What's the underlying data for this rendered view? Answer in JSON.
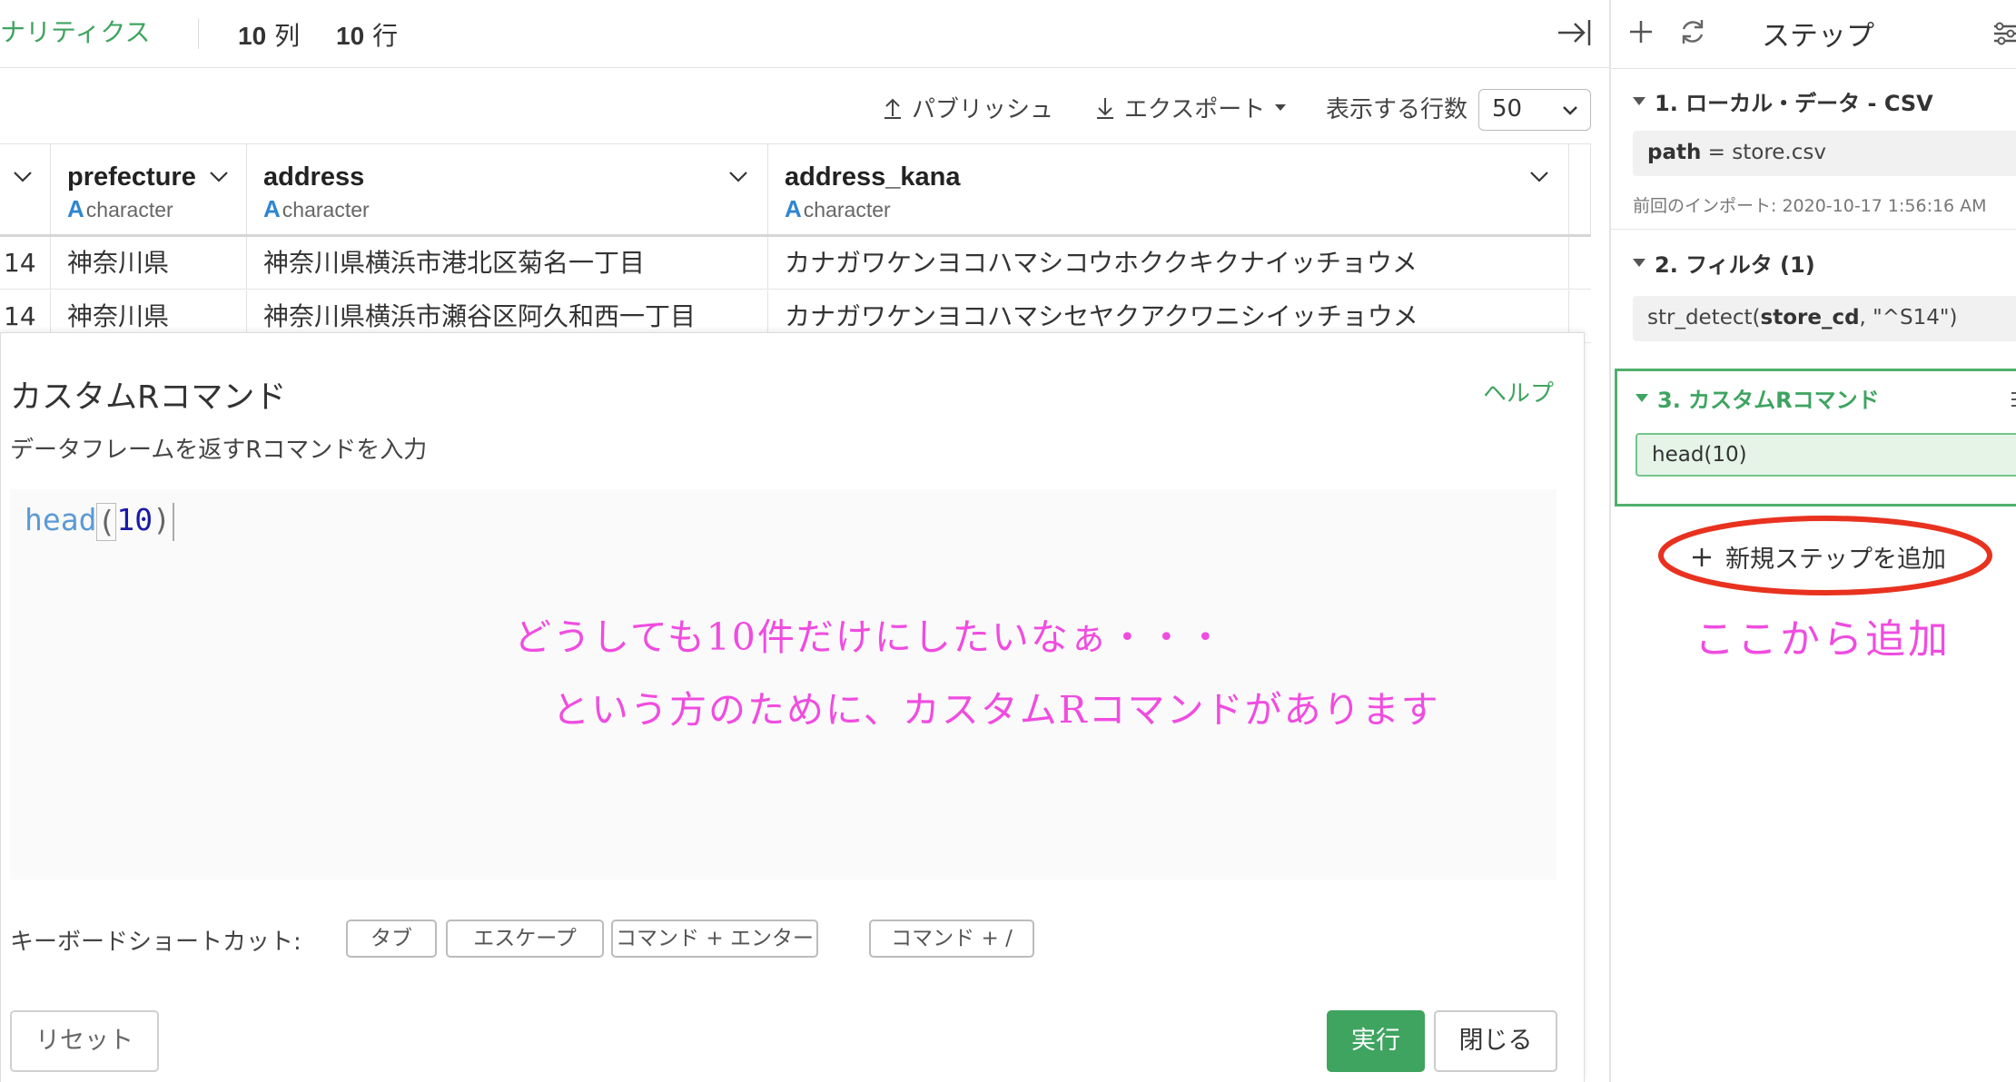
{
  "header": {
    "app_title": "ナリティクス",
    "columns_num": "10",
    "columns_unit": "列",
    "rows_num": "10",
    "rows_unit": "行"
  },
  "toolbar": {
    "publish_label": "パブリッシュ",
    "export_label": "エクスポート",
    "rows_label": "表示する行数",
    "rows_value": "50"
  },
  "table": {
    "columns": [
      {
        "name": "prefecture",
        "type": "character"
      },
      {
        "name": "address",
        "type": "character"
      },
      {
        "name": "address_kana",
        "type": "character"
      }
    ],
    "type_letter": "A",
    "rows": [
      {
        "id": "14",
        "prefecture": "神奈川県",
        "address": "神奈川県横浜市港北区菊名一丁目",
        "address_kana": "カナガワケンヨコハマシコウホククキクナイッチョウメ"
      },
      {
        "id": "14",
        "prefecture": "神奈川県",
        "address": "神奈川県横浜市瀬谷区阿久和西一丁目",
        "address_kana": "カナガワケンヨコハマシセヤクアクワニシイッチョウメ"
      }
    ]
  },
  "dialog": {
    "title": "カスタムRコマンド",
    "help_label": "ヘルプ",
    "description": "データフレームを返すRコマンドを入力",
    "code_fn": "head",
    "code_open": "(",
    "code_arg": "10",
    "code_close": ")",
    "annotation_line1": "どうしても10件だけにしたいなぁ・・・",
    "annotation_line2": "という方のために、カスタムRコマンドがあります",
    "shortcuts_label": "キーボードショートカット:",
    "shortcuts": [
      "タブ",
      "エスケープ",
      "コマンド + エンター",
      "コマンド + /"
    ],
    "reset_label": "リセット",
    "run_label": "実行",
    "close_label": "閉じる"
  },
  "steps_panel": {
    "title": "ステップ",
    "steps": [
      {
        "heading": "1. ローカル・データ - CSV",
        "key": "path",
        "value": " = store.csv",
        "note": "前回のインポート: 2020-10-17 1:56:16 AM"
      },
      {
        "heading": "2. フィルタ (1)",
        "pre": "str_detect(",
        "bold": "store_cd",
        "post": ", \"^S14\")"
      },
      {
        "heading": "3. カスタムRコマンド",
        "code": "head(10)"
      }
    ],
    "add_step_label": "新規ステップを追加",
    "annotation": "ここから追加"
  },
  "colors": {
    "accent": "#3ea460",
    "annotation": "#f04ce0",
    "ellipse": "#e8321f",
    "type_icon": "#2f86d1"
  }
}
